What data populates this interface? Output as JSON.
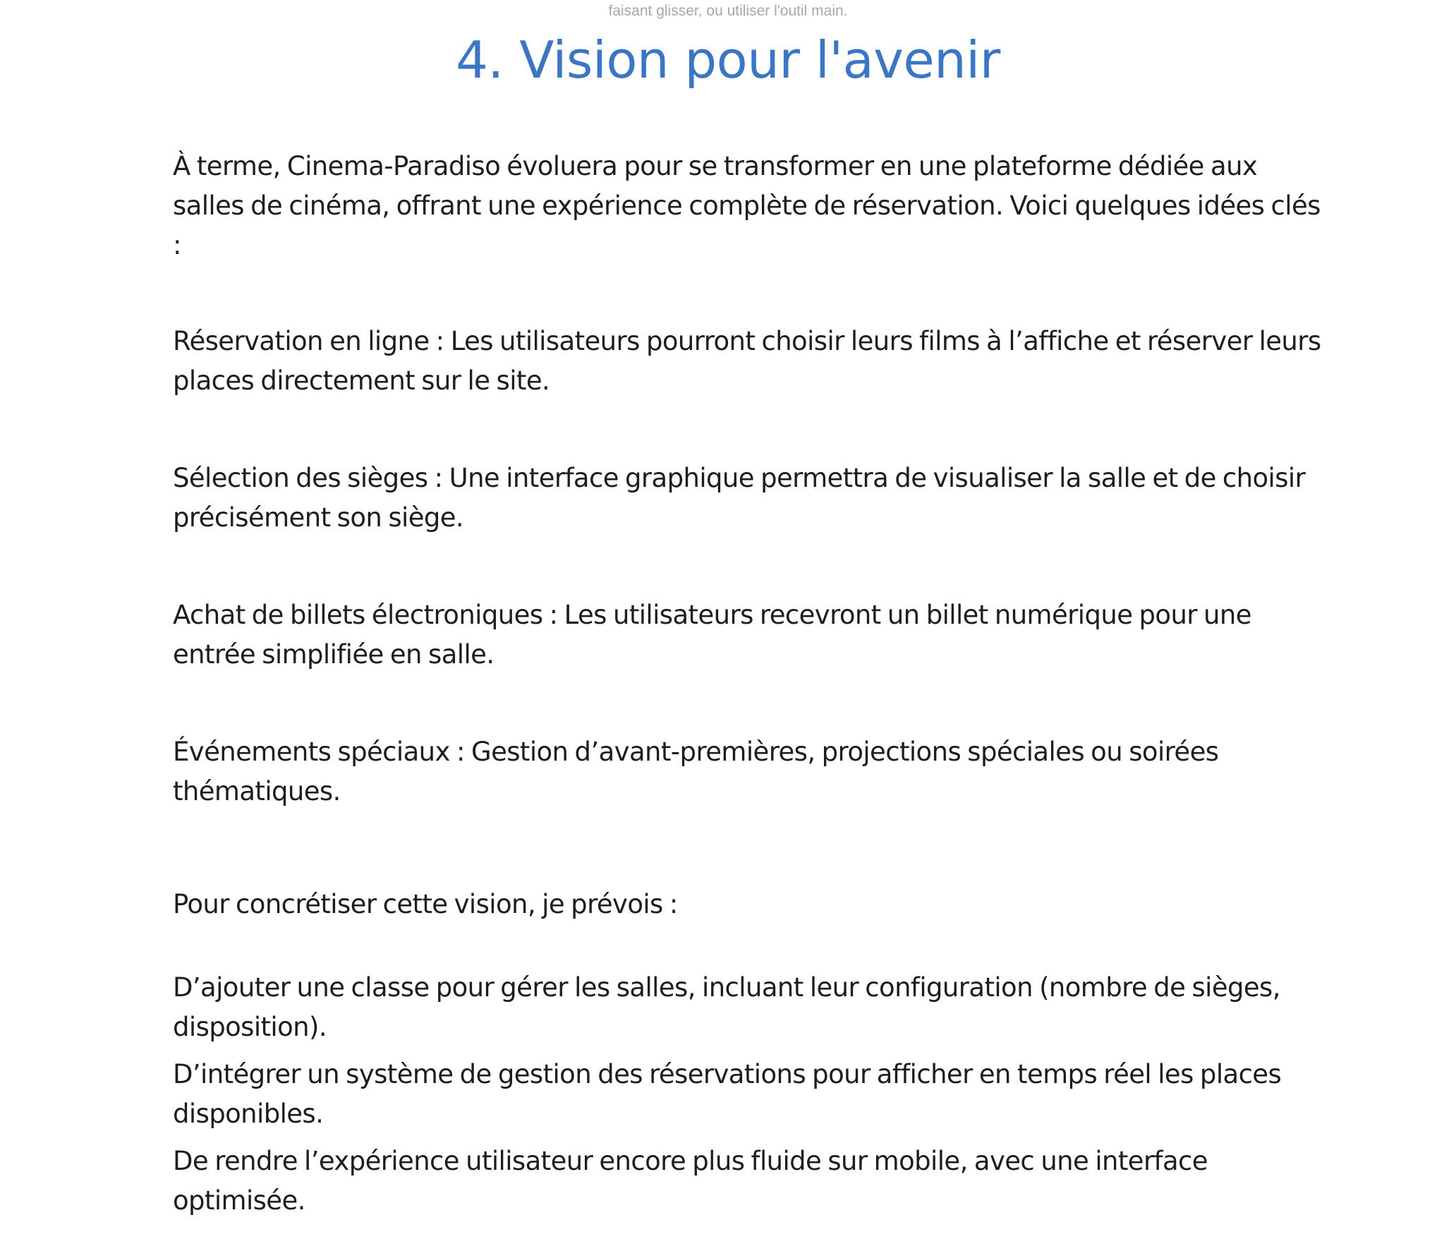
{
  "caption": "faisant glisser, ou utiliser l'outil main.",
  "title": "4. Vision pour l'avenir",
  "intro": "À terme, Cinema-Paradiso évoluera pour se transformer en une plateforme dédiée aux salles de cinéma, offrant une expérience complète de réservation. Voici quelques idées clés :",
  "features": [
    "Réservation en ligne : Les utilisateurs pourront choisir leurs films à l’affiche et réserver leurs places directement sur le site.",
    "Sélection des sièges : Une interface graphique permettra de visualiser la salle et de choisir précisément son siège.",
    "Achat de billets électroniques : Les utilisateurs recevront un billet numérique pour une entrée simplifiée en salle.",
    "Événements spéciaux : Gestion d’avant-premières, projections spéciales ou soirées thématiques."
  ],
  "plan_intro": "Pour concrétiser cette vision, je prévois :",
  "plan_items": [
    "D’ajouter une classe pour gérer les salles, incluant leur configuration (nombre de sièges, disposition).",
    "D’intégrer un système de gestion des réservations pour afficher en temps réel les places disponibles.",
    "De rendre l’expérience utilisateur encore plus fluide sur mobile, avec une interface optimisée."
  ]
}
